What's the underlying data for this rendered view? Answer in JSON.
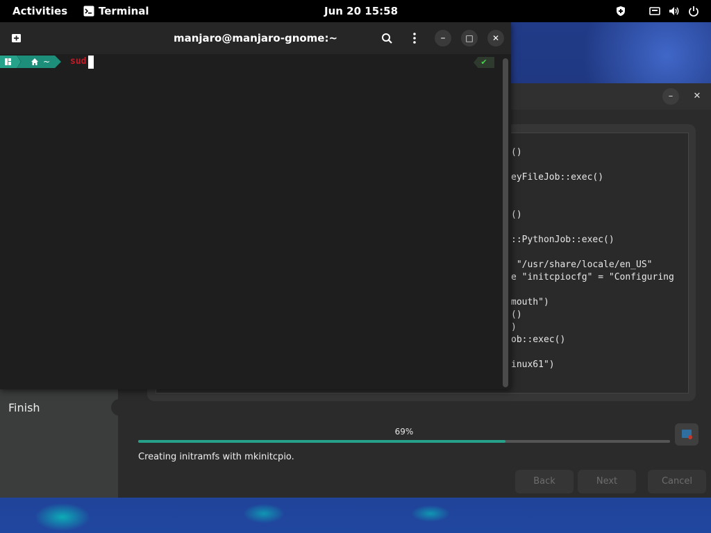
{
  "topbar": {
    "activities": "Activities",
    "app_name": "Terminal",
    "app_icon": "terminal-app-icon",
    "clock": "Jun 20  15:58",
    "indicators": [
      "shield-icon",
      "network-icon",
      "volume-icon",
      "power-icon"
    ]
  },
  "terminal": {
    "title": "manjaro@manjaro-gnome:~",
    "new_tab_icon": "new-tab-icon",
    "search_icon": "search-icon",
    "menu_icon": "kebab-menu-icon",
    "minimize": "–",
    "maximize": "□",
    "close": "✕",
    "prompt": {
      "logo_segment": "manjaro-logo",
      "home_segment": "~",
      "command": "sud"
    },
    "status_indicator": "✔"
  },
  "installer": {
    "window_buttons": {
      "minimize": "–",
      "close": "✕"
    },
    "log_lines": [
      "()",
      "eyFileJob::exec()",
      "()",
      "::PythonJob::exec()",
      " \"/usr/share/locale/en_US\"",
      "e \"initcpiocfg\" = \"Configuring",
      "mouth\")",
      "()",
      ")",
      "ob::exec()",
      "inux61\")"
    ],
    "sidebar": {
      "current_step": "Finish"
    },
    "progress": {
      "percent_text": "69%",
      "value": 0.69
    },
    "status_text": "Creating initramfs with mkinitcpio.",
    "buttons": {
      "back": "Back",
      "next": "Next",
      "cancel": "Cancel"
    }
  },
  "colors": {
    "accent": "#26a18a",
    "prompt_green": "#26a18a",
    "command_red": "#c01c28",
    "topbar_bg": "#000000"
  }
}
